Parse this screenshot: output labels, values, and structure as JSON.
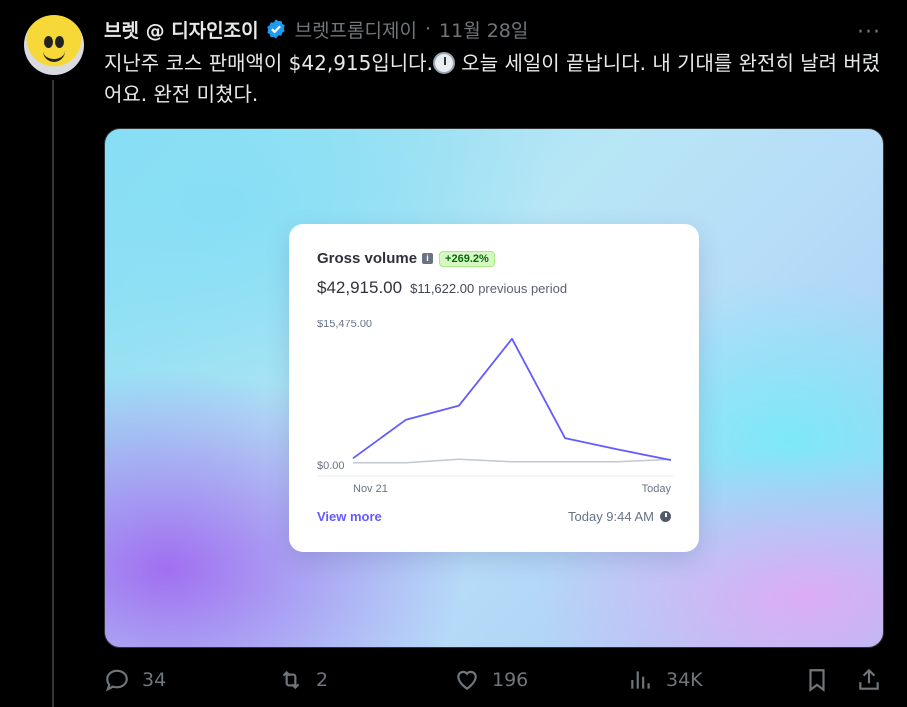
{
  "author": {
    "name": "브렛 @ 디자인조이",
    "handle": "브렛프롬디제이",
    "separator": "·",
    "date": "11월 28일"
  },
  "tweet": {
    "text_part1": "지난주 코스 판매액이 $42,915입니다.",
    "emoji": "clock-emoji",
    "text_part2": " 오늘 세일이 끝납니다. 내 기대를 완전히 날려 버렸어요. 완전 미쳤다."
  },
  "card": {
    "title": "Gross volume",
    "change_badge": "+269.2%",
    "amount": "$42,915.00",
    "previous_amount": "$11,622.00",
    "previous_label": "previous period",
    "view_more": "View more",
    "updated": "Today 9:44 AM"
  },
  "chart_data": {
    "type": "line",
    "title": "Gross volume",
    "x_start_label": "Nov 21",
    "x_end_label": "Today",
    "y_max_label": "$15,475.00",
    "y_min_label": "$0.00",
    "ylim": [
      0,
      15475
    ],
    "series": [
      {
        "name": "current",
        "color": "#635bff",
        "values": [
          1100,
          5500,
          7100,
          14700,
          3400,
          2100,
          900
        ]
      },
      {
        "name": "previous",
        "color": "#c0c8d2",
        "values": [
          600,
          600,
          1000,
          700,
          700,
          700,
          1000
        ]
      }
    ],
    "grid": false
  },
  "actions": {
    "replies": "34",
    "retweets": "2",
    "likes": "196",
    "views": "34K"
  },
  "colors": {
    "background": "#000000",
    "text": "#e7e9ea",
    "muted": "#71767b",
    "verified": "#1d9bf0",
    "accent": "#635bff"
  }
}
